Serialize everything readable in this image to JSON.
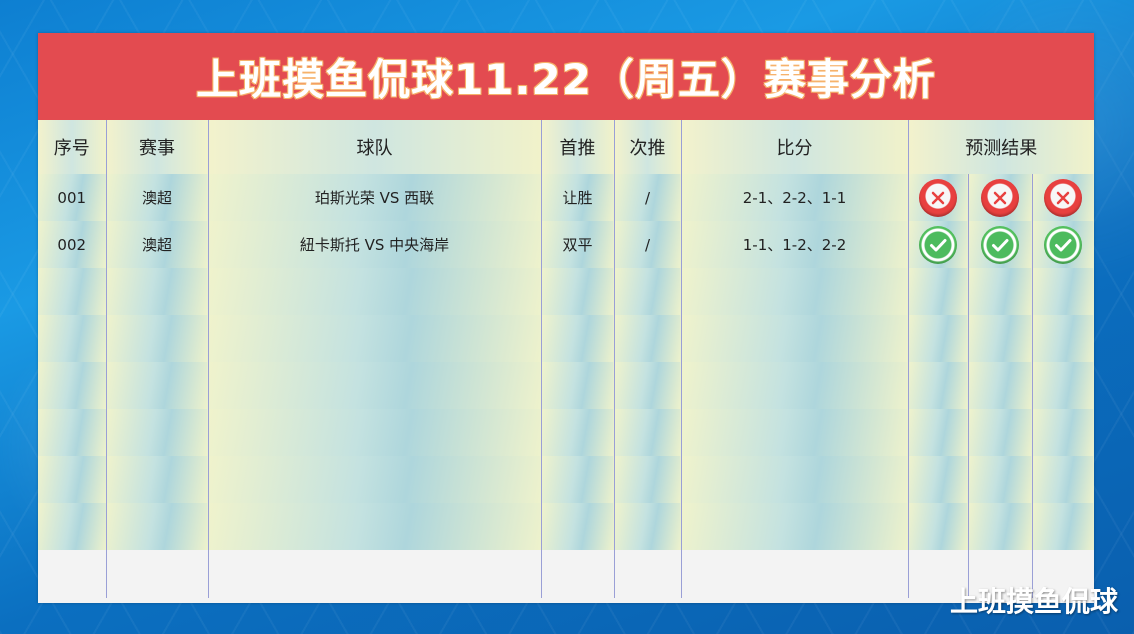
{
  "title": "上班摸鱼侃球11.22（周五）赛事分析",
  "columns": {
    "no": "序号",
    "league": "赛事",
    "teams": "球队",
    "first_pick": "首推",
    "second_pick": "次推",
    "score": "比分",
    "result": "预测结果"
  },
  "rows": [
    {
      "no": "001",
      "league": "澳超",
      "teams": "珀斯光荣 VS 西联",
      "first_pick": "让胜",
      "second_pick": "/",
      "score": "2-1、2-2、1-1",
      "results": [
        "wrong",
        "wrong",
        "wrong"
      ]
    },
    {
      "no": "002",
      "league": "澳超",
      "teams": "紐卡斯托 VS 中央海岸",
      "first_pick": "双平",
      "second_pick": "/",
      "score": "1-1、1-2、2-2",
      "results": [
        "correct",
        "correct",
        "correct"
      ]
    }
  ],
  "colors": {
    "title_bg": "#e34b50",
    "wrong": "#e8403f",
    "correct": "#53c05e"
  },
  "icons": {
    "wrong": "x-circle-icon",
    "correct": "check-circle-icon"
  },
  "watermark": "上班摸鱼侃球"
}
